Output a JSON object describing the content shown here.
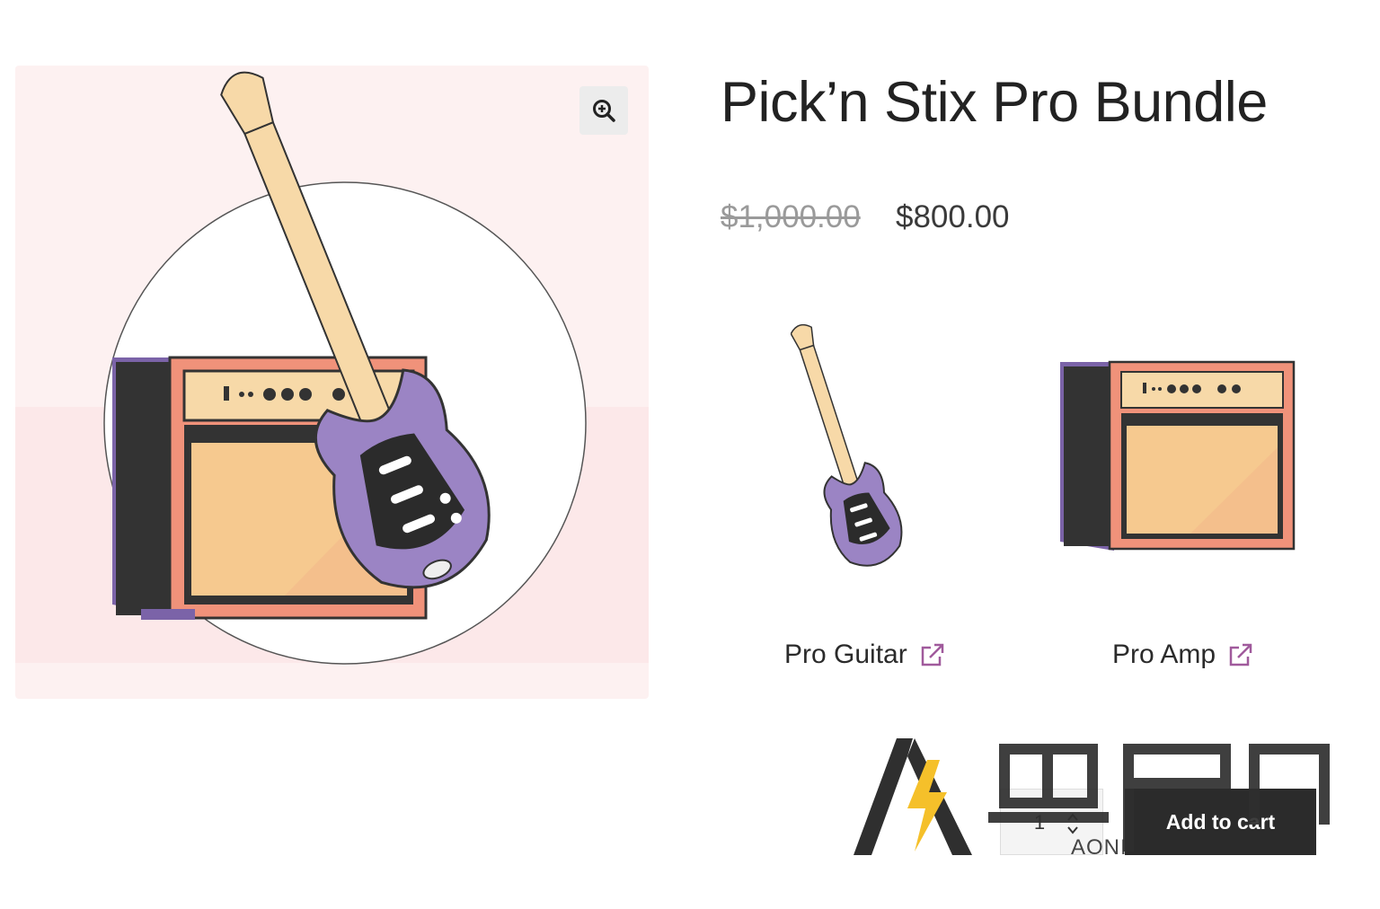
{
  "product": {
    "title": "Pick’n Stix Pro Bundle",
    "regular_price": "$1,000.00",
    "sale_price": "$800.00",
    "quantity": "1",
    "add_to_cart_label": "Add to cart"
  },
  "gallery": {
    "zoom_icon": "zoom-in-icon",
    "background_color": "#fdf1f1"
  },
  "bundle": {
    "items": [
      {
        "label": "Pro Guitar",
        "icon": "external-link-icon"
      },
      {
        "label": "Pro Amp",
        "icon": "external-link-icon"
      }
    ]
  },
  "watermark": {
    "text": "AONI",
    "logo": "aoni-logo"
  },
  "colors": {
    "accent_link": "#a05a9c",
    "button_bg": "#2b2b2b",
    "guitar_purple": "#9b84c4",
    "amp_orange": "#f0927a"
  }
}
